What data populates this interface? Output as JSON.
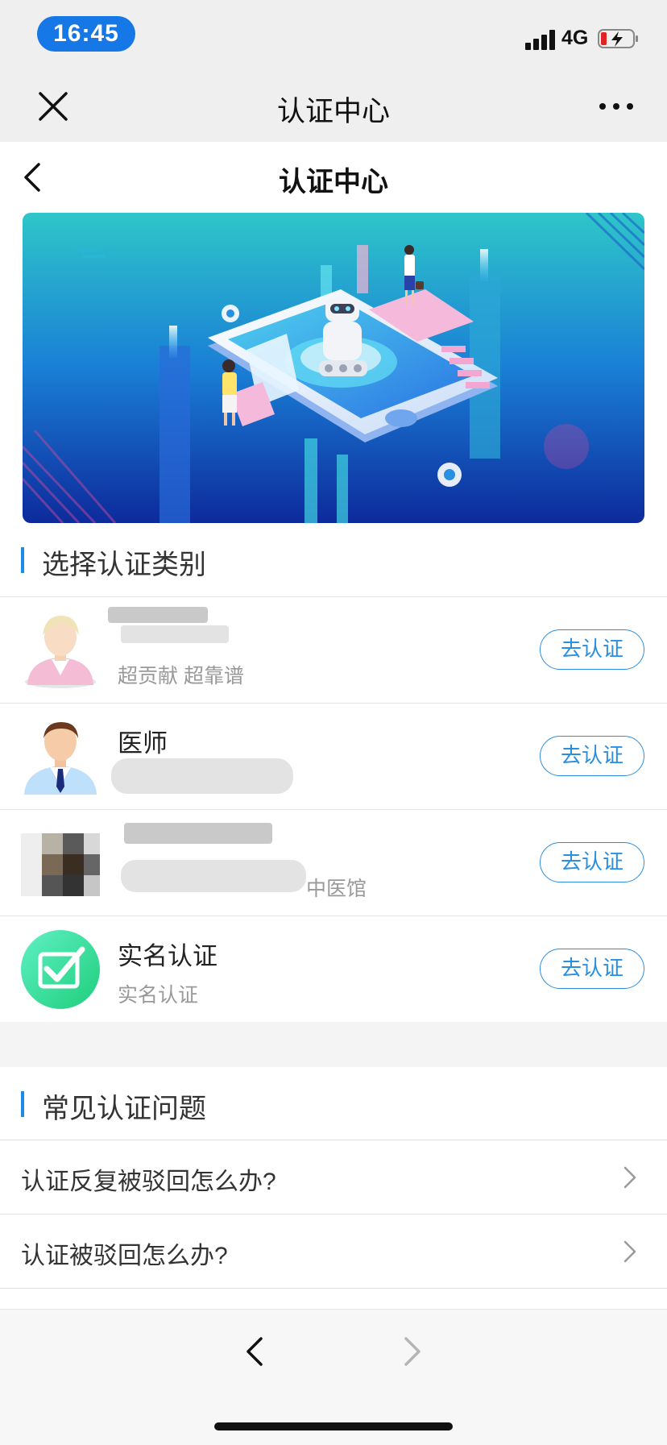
{
  "status_bar": {
    "time": "16:45",
    "network": "4G",
    "signal_icon": "signal-bars-icon",
    "battery_icon": "battery-charging-icon",
    "battery_low": true
  },
  "wechat_nav": {
    "title": "认证中心",
    "close_icon": "close-icon",
    "more_icon": "more-dots-icon"
  },
  "page_header": {
    "title": "认证中心",
    "back_icon": "chevron-left-icon"
  },
  "banner": {
    "theme_colors": [
      "#2ec6c9",
      "#1a5bd0",
      "#0d2a9c"
    ]
  },
  "cert_section": {
    "title": "选择认证类别",
    "items": [
      {
        "title": "",
        "subtitle": "超贡献 超靠谱",
        "button": "去认证",
        "avatar": "female-avatar-icon"
      },
      {
        "title": "医师",
        "subtitle": "",
        "button": "去认证",
        "avatar": "doctor-avatar-icon"
      },
      {
        "title": "",
        "subtitle": "中医馆",
        "button": "去认证",
        "avatar": "clinic-avatar-icon"
      },
      {
        "title": "实名认证",
        "subtitle": "实名认证",
        "button": "去认证",
        "avatar": "checkbox-icon"
      }
    ]
  },
  "faq_section": {
    "title": "常见认证问题",
    "items": [
      {
        "question": "认证反复被驳回怎么办?"
      },
      {
        "question": "认证被驳回怎么办?"
      }
    ]
  },
  "bottom_nav": {
    "back_icon": "chevron-left-icon",
    "forward_icon": "chevron-right-icon"
  },
  "colors": {
    "accent": "#2b8fe0",
    "time_pill": "#1677e6",
    "section_bar": "#1e8be4"
  }
}
